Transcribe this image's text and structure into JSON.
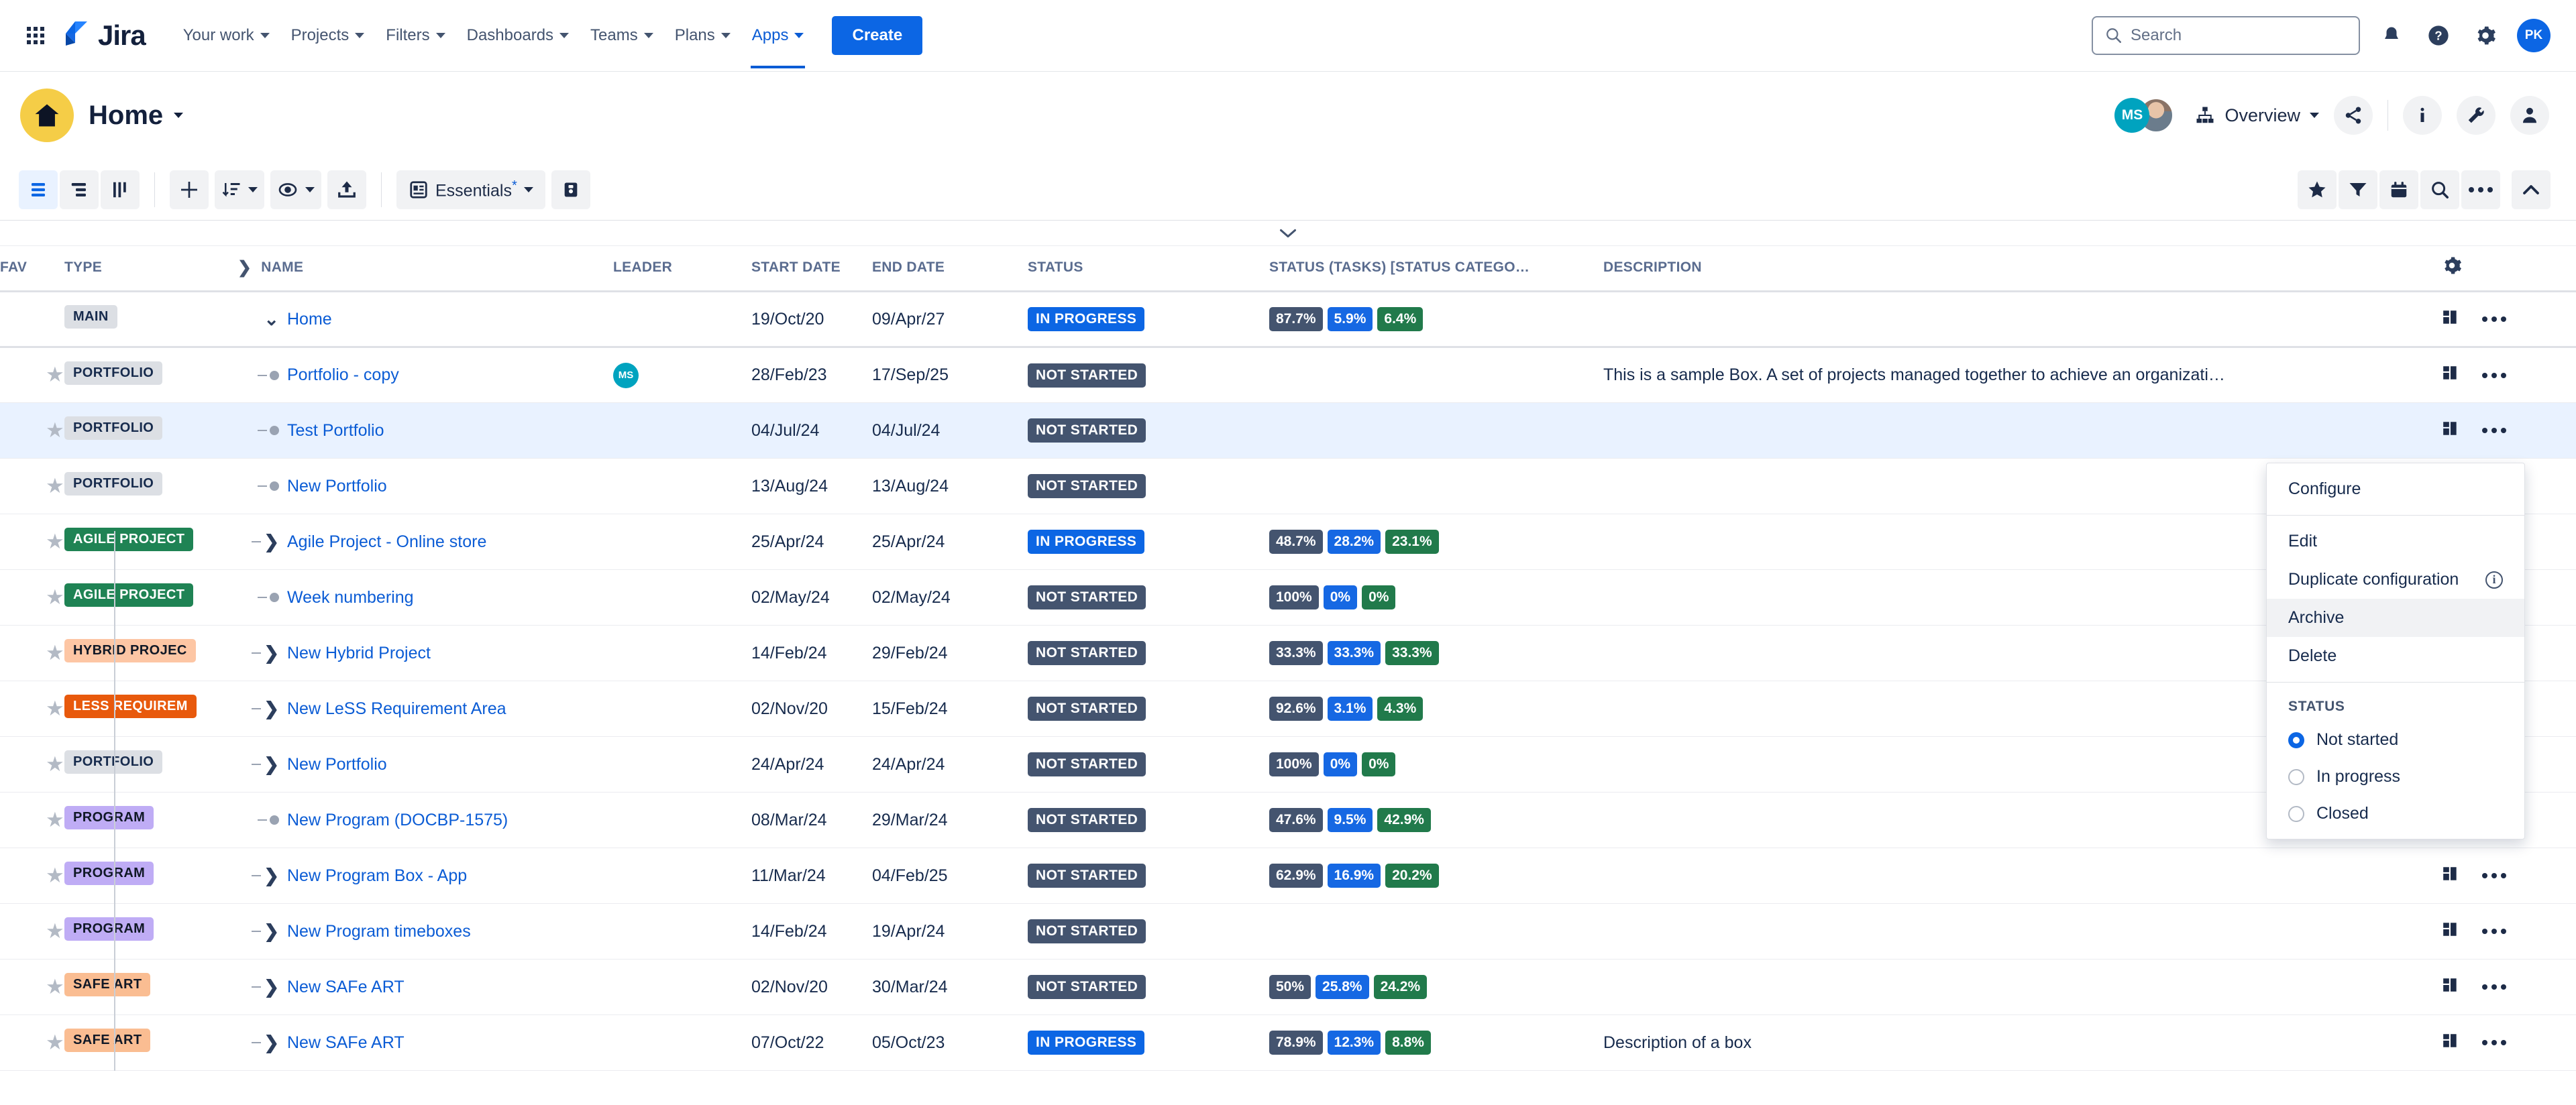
{
  "topnav": {
    "brand": "Jira",
    "items": [
      {
        "label": "Your work",
        "active": false
      },
      {
        "label": "Projects",
        "active": false
      },
      {
        "label": "Filters",
        "active": false
      },
      {
        "label": "Dashboards",
        "active": false
      },
      {
        "label": "Teams",
        "active": false
      },
      {
        "label": "Plans",
        "active": false
      },
      {
        "label": "Apps",
        "active": true
      }
    ],
    "create_label": "Create",
    "search_placeholder": "Search",
    "avatar_initials": "PK"
  },
  "pageheader": {
    "title": "Home",
    "avatar_ms": "MS",
    "overview_label": "Overview"
  },
  "toolbar": {
    "essentials_label": "Essentials",
    "essentials_modified": "*"
  },
  "table": {
    "columns": [
      {
        "key": "fav",
        "label": "FAV"
      },
      {
        "key": "type",
        "label": "TYPE"
      },
      {
        "key": "name",
        "label": "NAME"
      },
      {
        "key": "leader",
        "label": "LEADER"
      },
      {
        "key": "start",
        "label": "START DATE"
      },
      {
        "key": "end",
        "label": "END DATE"
      },
      {
        "key": "status",
        "label": "STATUS"
      },
      {
        "key": "tasks",
        "label": "STATUS (TASKS) [STATUS CATEGO…"
      },
      {
        "key": "description",
        "label": "DESCRIPTION"
      }
    ],
    "rows": [
      {
        "fav": false,
        "type": "MAIN",
        "type_style": "b-main",
        "twisty": "expanded",
        "indent": 0,
        "name": "Home",
        "leader": "",
        "start": "19/Oct/20",
        "end": "09/Apr/27",
        "status": "IN PROGRESS",
        "status_style": "st-inprogress",
        "tasks": [
          "87.7%",
          "5.9%",
          "6.4%"
        ],
        "description": "",
        "selected": false,
        "is_main": true
      },
      {
        "fav": true,
        "type": "PORTFOLIO",
        "type_style": "b-portfolio",
        "twisty": "leaf",
        "indent": 1,
        "name": "Portfolio - copy",
        "leader": "MS",
        "start": "28/Feb/23",
        "end": "17/Sep/25",
        "status": "NOT STARTED",
        "status_style": "st-notstarted",
        "tasks": [],
        "description": "This is a sample Box. A set of projects managed together to achieve an organizati…",
        "selected": false,
        "is_main": false
      },
      {
        "fav": true,
        "type": "PORTFOLIO",
        "type_style": "b-portfolio",
        "twisty": "leaf",
        "indent": 1,
        "name": "Test Portfolio",
        "leader": "",
        "start": "04/Jul/24",
        "end": "04/Jul/24",
        "status": "NOT STARTED",
        "status_style": "st-notstarted",
        "tasks": [],
        "description": "",
        "selected": true,
        "is_main": false
      },
      {
        "fav": true,
        "type": "PORTFOLIO",
        "type_style": "b-portfolio",
        "twisty": "leaf",
        "indent": 1,
        "name": "New Portfolio",
        "leader": "",
        "start": "13/Aug/24",
        "end": "13/Aug/24",
        "status": "NOT STARTED",
        "status_style": "st-notstarted",
        "tasks": [],
        "description": "",
        "selected": false,
        "is_main": false
      },
      {
        "fav": true,
        "type": "AGILE PROJECT",
        "type_style": "b-agile",
        "twisty": "collapsed",
        "indent": 1,
        "name": "Agile Project - Online store",
        "leader": "",
        "start": "25/Apr/24",
        "end": "25/Apr/24",
        "status": "IN PROGRESS",
        "status_style": "st-inprogress",
        "tasks": [
          "48.7%",
          "28.2%",
          "23.1%"
        ],
        "description": "",
        "selected": false,
        "is_main": false
      },
      {
        "fav": true,
        "type": "AGILE PROJECT",
        "type_style": "b-agile",
        "twisty": "leaf",
        "indent": 1,
        "name": "Week numbering",
        "leader": "",
        "start": "02/May/24",
        "end": "02/May/24",
        "status": "NOT STARTED",
        "status_style": "st-notstarted",
        "tasks": [
          "100%",
          "0%",
          "0%"
        ],
        "description": "",
        "selected": false,
        "is_main": false
      },
      {
        "fav": true,
        "type": "HYBRID PROJEC",
        "type_style": "b-hybrid",
        "twisty": "collapsed",
        "indent": 1,
        "name": "New Hybrid Project",
        "leader": "",
        "start": "14/Feb/24",
        "end": "29/Feb/24",
        "status": "NOT STARTED",
        "status_style": "st-notstarted",
        "tasks": [
          "33.3%",
          "33.3%",
          "33.3%"
        ],
        "description": "",
        "selected": false,
        "is_main": false
      },
      {
        "fav": true,
        "type": "LESS REQUIREM",
        "type_style": "b-less",
        "twisty": "collapsed",
        "indent": 1,
        "name": "New LeSS Requirement Area",
        "leader": "",
        "start": "02/Nov/20",
        "end": "15/Feb/24",
        "status": "NOT STARTED",
        "status_style": "st-notstarted",
        "tasks": [
          "92.6%",
          "3.1%",
          "4.3%"
        ],
        "description": "",
        "selected": false,
        "is_main": false
      },
      {
        "fav": true,
        "type": "PORTFOLIO",
        "type_style": "b-portfolio",
        "twisty": "collapsed",
        "indent": 1,
        "name": "New Portfolio",
        "leader": "",
        "start": "24/Apr/24",
        "end": "24/Apr/24",
        "status": "NOT STARTED",
        "status_style": "st-notstarted",
        "tasks": [
          "100%",
          "0%",
          "0%"
        ],
        "description": "",
        "selected": false,
        "is_main": false
      },
      {
        "fav": true,
        "type": "PROGRAM",
        "type_style": "b-program",
        "twisty": "leaf",
        "indent": 1,
        "name": "New Program (DOCBP-1575)",
        "leader": "",
        "start": "08/Mar/24",
        "end": "29/Mar/24",
        "status": "NOT STARTED",
        "status_style": "st-notstarted",
        "tasks": [
          "47.6%",
          "9.5%",
          "42.9%"
        ],
        "description": "",
        "selected": false,
        "is_main": false
      },
      {
        "fav": true,
        "type": "PROGRAM",
        "type_style": "b-program",
        "twisty": "collapsed",
        "indent": 1,
        "name": "New Program Box - App",
        "leader": "",
        "start": "11/Mar/24",
        "end": "04/Feb/25",
        "status": "NOT STARTED",
        "status_style": "st-notstarted",
        "tasks": [
          "62.9%",
          "16.9%",
          "20.2%"
        ],
        "description": "",
        "selected": false,
        "is_main": false
      },
      {
        "fav": true,
        "type": "PROGRAM",
        "type_style": "b-program",
        "twisty": "collapsed",
        "indent": 1,
        "name": "New Program timeboxes",
        "leader": "",
        "start": "14/Feb/24",
        "end": "19/Apr/24",
        "status": "NOT STARTED",
        "status_style": "st-notstarted",
        "tasks": [],
        "description": "",
        "selected": false,
        "is_main": false
      },
      {
        "fav": true,
        "type": "SAFE ART",
        "type_style": "b-safe",
        "twisty": "collapsed",
        "indent": 1,
        "name": "New SAFe ART",
        "leader": "",
        "start": "02/Nov/20",
        "end": "30/Mar/24",
        "status": "NOT STARTED",
        "status_style": "st-notstarted",
        "tasks": [
          "50%",
          "25.8%",
          "24.2%"
        ],
        "description": "",
        "selected": false,
        "is_main": false
      },
      {
        "fav": true,
        "type": "SAFE ART",
        "type_style": "b-safe",
        "twisty": "collapsed",
        "indent": 1,
        "name": "New SAFe ART",
        "leader": "",
        "start": "07/Oct/22",
        "end": "05/Oct/23",
        "status": "IN PROGRESS",
        "status_style": "st-inprogress",
        "tasks": [
          "78.9%",
          "12.3%",
          "8.8%"
        ],
        "description": "Description of a box",
        "selected": false,
        "is_main": false
      }
    ]
  },
  "contextmenu": {
    "items": [
      {
        "label": "Configure",
        "highlighted": false,
        "info": false
      },
      {
        "label": "Edit",
        "highlighted": false,
        "info": false
      },
      {
        "label": "Duplicate configuration",
        "highlighted": false,
        "info": true
      },
      {
        "label": "Archive",
        "highlighted": true,
        "info": false
      },
      {
        "label": "Delete",
        "highlighted": false,
        "info": false
      }
    ],
    "status_header": "STATUS",
    "status_options": [
      {
        "label": "Not started",
        "selected": true
      },
      {
        "label": "In progress",
        "selected": false
      },
      {
        "label": "Closed",
        "selected": false
      }
    ]
  },
  "colors": {
    "brand_blue": "#0c66e4",
    "link_blue": "#0b5cd5",
    "home_yellow": "#f5cd47",
    "status_grey": "#44546f",
    "status_green": "#217a4b",
    "selected_row": "#e9f2ff"
  }
}
